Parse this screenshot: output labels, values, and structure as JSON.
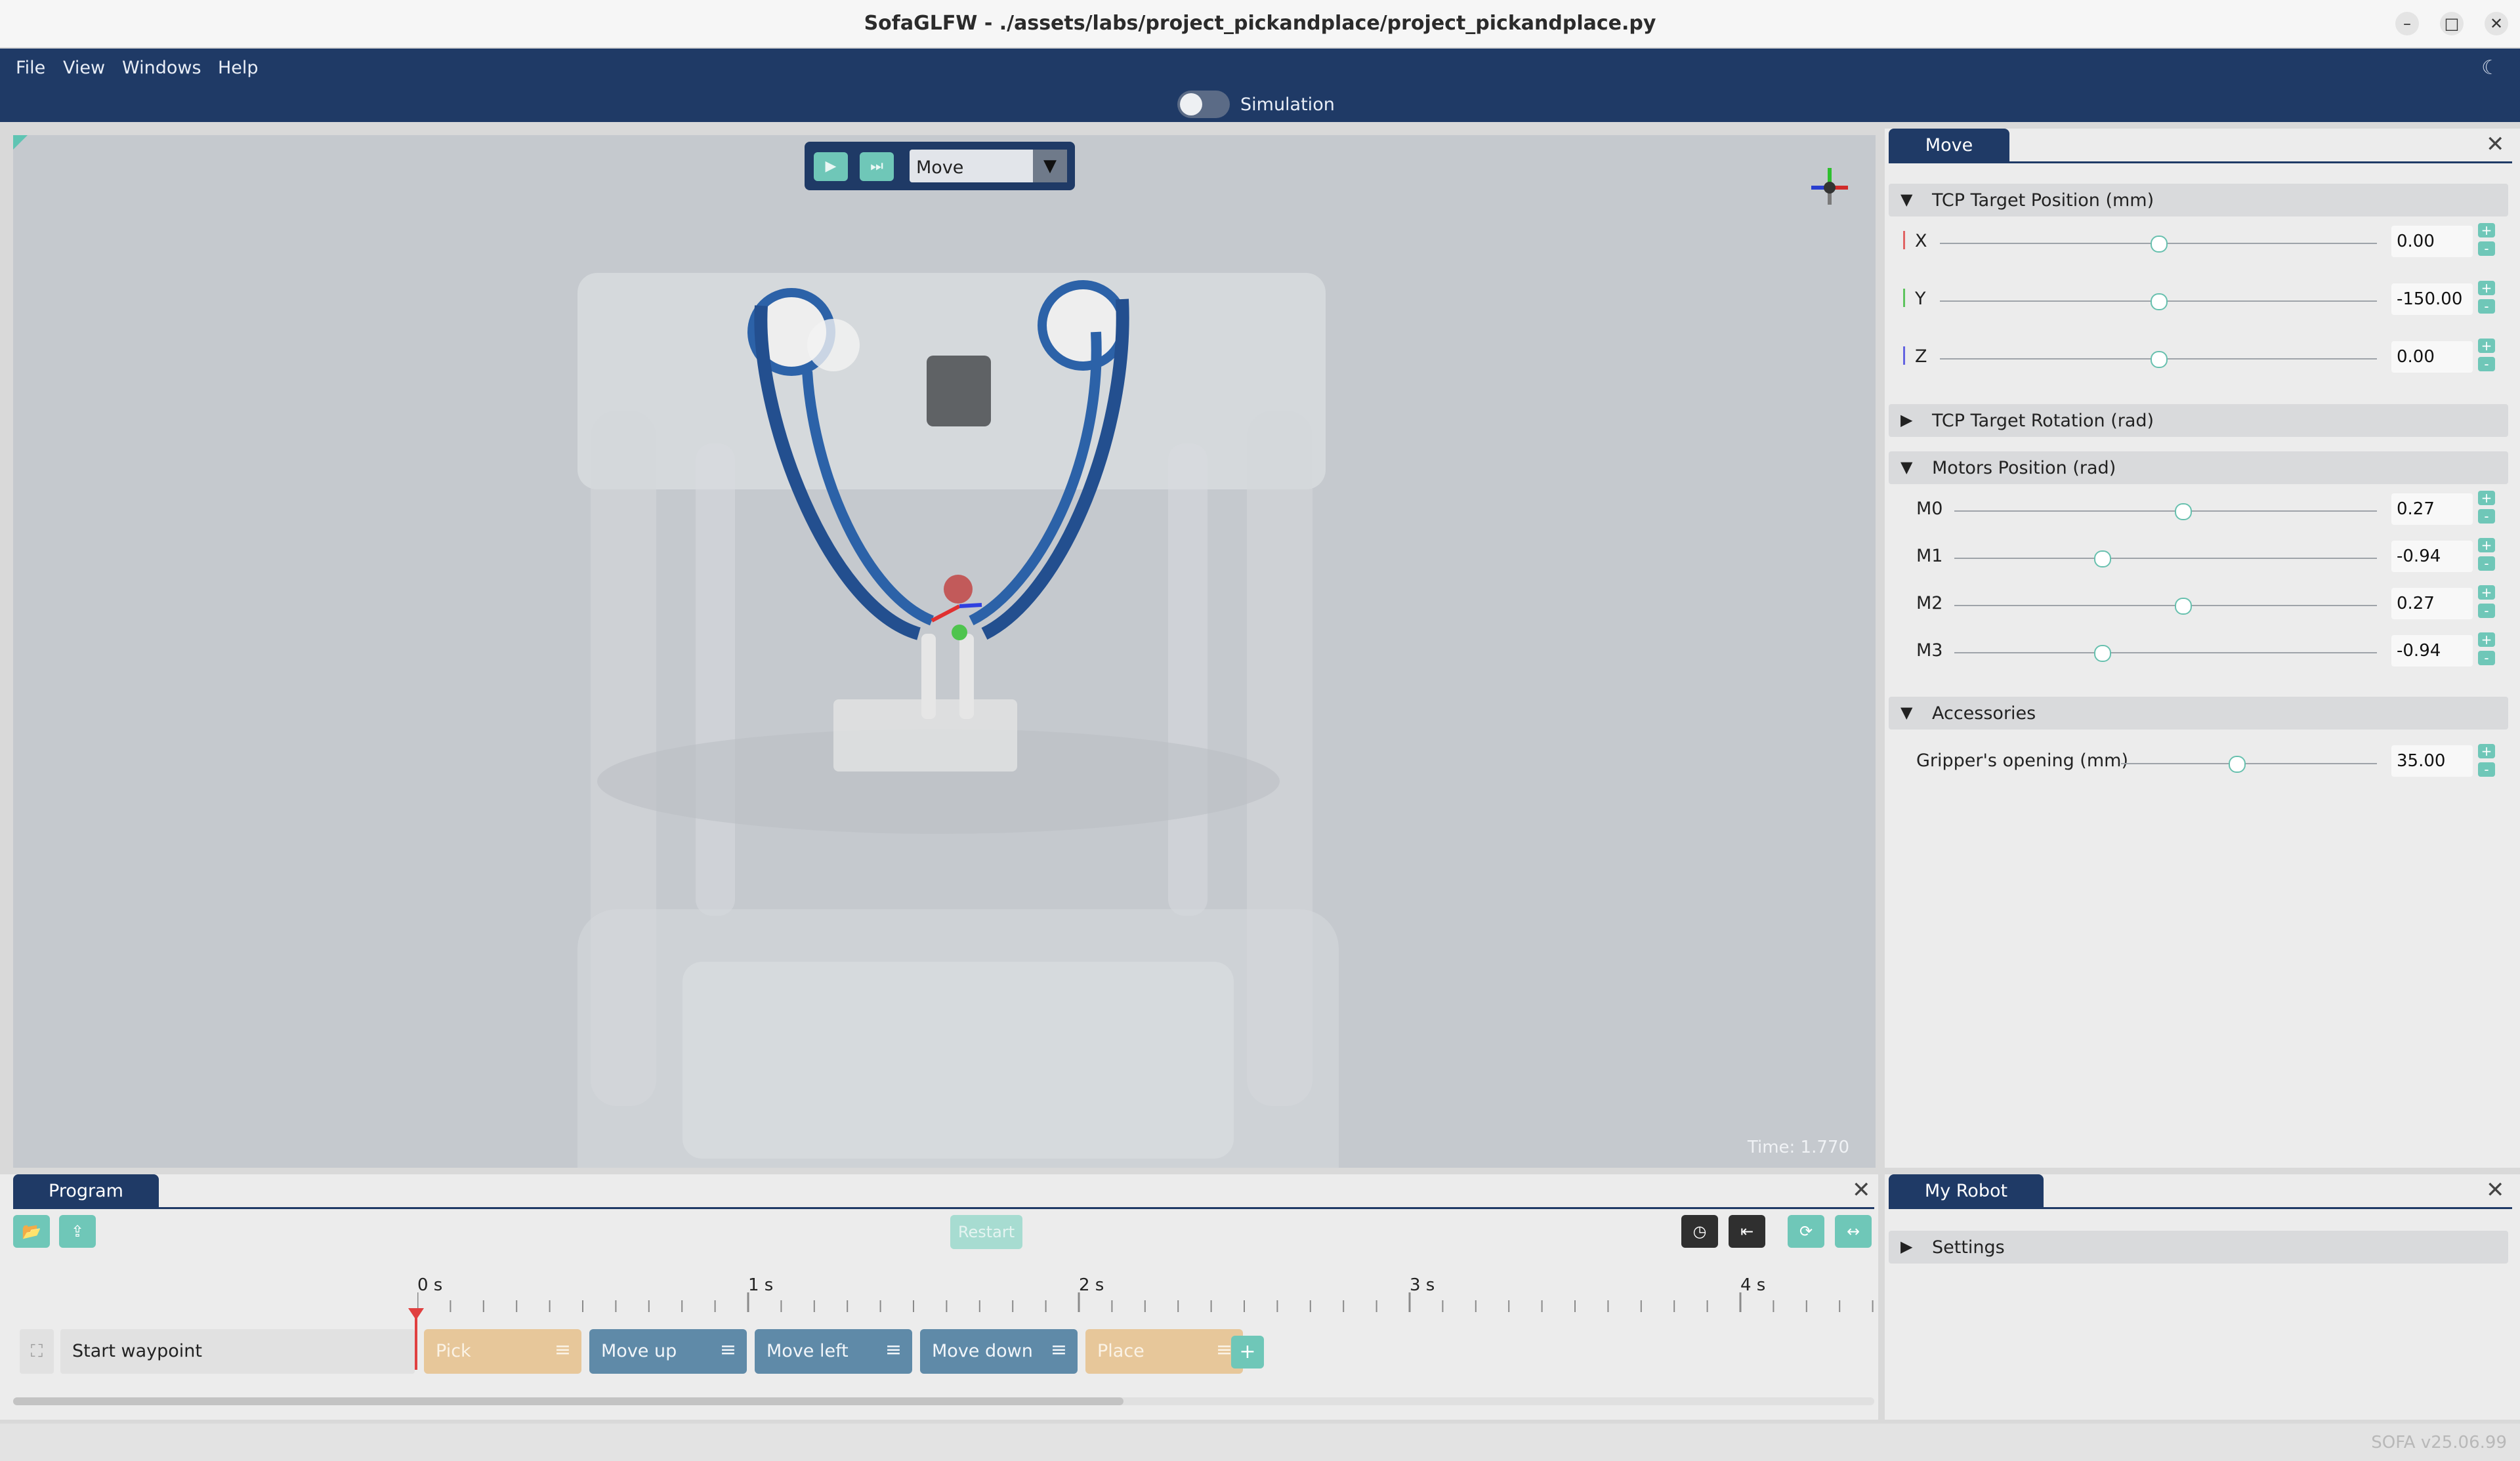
{
  "window": {
    "title": "SofaGLFW - ./assets/labs/project_pickandplace/project_pickandplace.py",
    "minimize": "–",
    "maximize": "□",
    "close": "✕"
  },
  "menubar": {
    "items": [
      "File",
      "View",
      "Windows",
      "Help"
    ],
    "theme_icon": "moon-icon"
  },
  "simbar": {
    "label": "Simulation",
    "toggle_on": false
  },
  "viewport": {
    "play_icon": "play-icon",
    "step_icon": "step-icon",
    "mode": "Move",
    "time": "Time: 1.770"
  },
  "move_panel": {
    "tab": "Move",
    "sections": {
      "tcp_position": "TCP Target Position (mm)",
      "tcp_rotation": "TCP Target Rotation (rad)",
      "motors": "Motors Position (rad)",
      "accessories": "Accessories"
    },
    "tcp_position": [
      {
        "label": "X",
        "value": "0.00",
        "fraction": 0.5,
        "color": "#e06464"
      },
      {
        "label": "Y",
        "value": "-150.00",
        "fraction": 0.5,
        "color": "#5ec45e"
      },
      {
        "label": "Z",
        "value": "0.00",
        "fraction": 0.5,
        "color": "#6464e0"
      }
    ],
    "motors": [
      {
        "label": "M0",
        "value": "0.27",
        "fraction": 0.54
      },
      {
        "label": "M1",
        "value": "-0.94",
        "fraction": 0.35
      },
      {
        "label": "M2",
        "value": "0.27",
        "fraction": 0.54
      },
      {
        "label": "M3",
        "value": "-0.94",
        "fraction": 0.35
      }
    ],
    "gripper": {
      "label": "Gripper's opening (mm)",
      "value": "35.00",
      "fraction": 0.45
    },
    "plus": "+",
    "minus": "-"
  },
  "program": {
    "tab": "Program",
    "restart": "Restart",
    "time_labels": [
      "0 s",
      "1 s",
      "2 s",
      "3 s",
      "4 s"
    ],
    "start_waypoint": "Start waypoint",
    "blocks": [
      {
        "label": "Pick",
        "kind": "gripper"
      },
      {
        "label": "Move up",
        "kind": "move"
      },
      {
        "label": "Move left",
        "kind": "move"
      },
      {
        "label": "Move down",
        "kind": "move"
      },
      {
        "label": "Place",
        "kind": "gripper"
      }
    ],
    "add": "+"
  },
  "my_robot": {
    "tab": "My Robot",
    "settings": "Settings"
  },
  "status": {
    "version": "SOFA v25.06.99"
  },
  "colors": {
    "accent_navy": "#1f3a66",
    "teal": "#6fc7b8",
    "move_block": "#5f8aa8",
    "gripper_block": "#e7c79a"
  }
}
